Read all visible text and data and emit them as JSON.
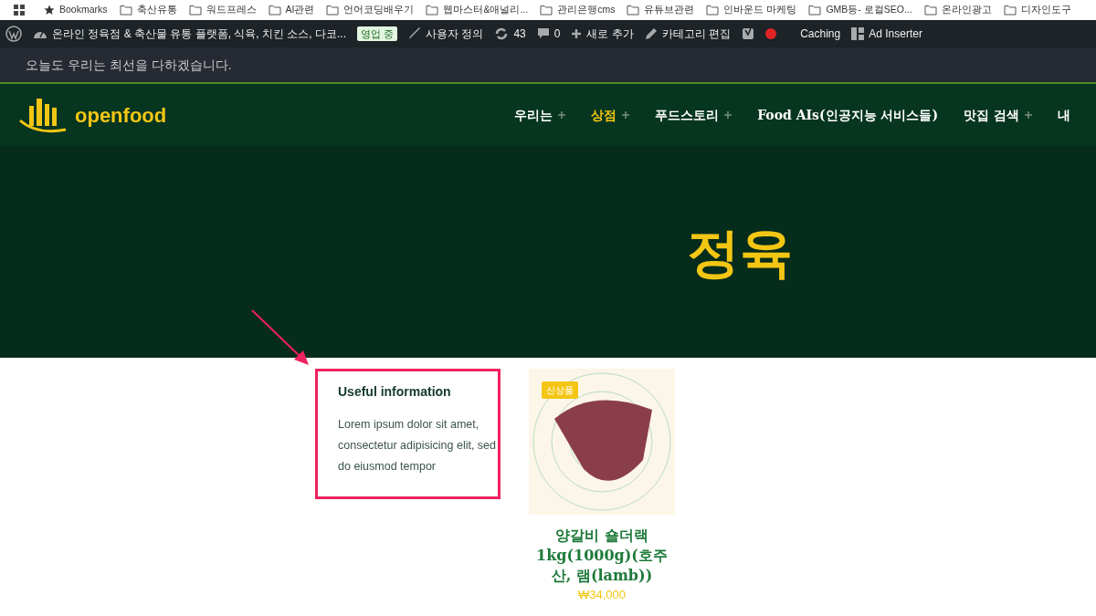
{
  "bookmarks_bar": {
    "items": [
      {
        "kind": "star",
        "label": "Bookmarks"
      },
      {
        "kind": "folder",
        "label": "축산유통"
      },
      {
        "kind": "folder",
        "label": "워드프레스"
      },
      {
        "kind": "folder",
        "label": "AI관련"
      },
      {
        "kind": "folder",
        "label": "언어코딩배우기"
      },
      {
        "kind": "folder",
        "label": "웹마스터&애널리..."
      },
      {
        "kind": "folder",
        "label": "관리은행cms"
      },
      {
        "kind": "folder",
        "label": "유튜브관련"
      },
      {
        "kind": "folder",
        "label": "인바운드 마케팅"
      },
      {
        "kind": "folder",
        "label": "GMB등- 로컬SEO..."
      },
      {
        "kind": "folder",
        "label": "온라인광고"
      },
      {
        "kind": "folder",
        "label": "디자인도구"
      }
    ]
  },
  "admin_bar": {
    "items": [
      {
        "kind": "wp"
      },
      {
        "kind": "site",
        "label": "온라인 정육점 & 축산물 유통 플랫폼, 식육, 치킨 소스, 다코..."
      },
      {
        "kind": "status",
        "label": "영업 중"
      },
      {
        "kind": "brush",
        "label": "사용자 정의"
      },
      {
        "kind": "updates",
        "label": "43"
      },
      {
        "kind": "comments",
        "label": "0"
      },
      {
        "kind": "plus",
        "label": "새로 추가"
      },
      {
        "kind": "pencil",
        "label": "카테고리 편집"
      },
      {
        "kind": "yoast"
      },
      {
        "kind": "dot",
        "color": "#e02424"
      },
      {
        "kind": "text",
        "label": "Caching"
      },
      {
        "kind": "adinserter",
        "label": "Ad Inserter"
      }
    ]
  },
  "top_bar": {
    "text": "오늘도 우리는 최선을 다하겠습니다."
  },
  "header": {
    "logo_text": "openfood",
    "nav": [
      {
        "label": "우리는",
        "selected": false,
        "has_submenu": true
      },
      {
        "label": "상점",
        "selected": true,
        "has_submenu": true
      },
      {
        "label": "푸드스토리",
        "selected": false,
        "has_submenu": true
      },
      {
        "label": "Food AIs(인공지능 서비스들)",
        "selected": false,
        "has_submenu": false
      },
      {
        "label": "맛집 검색",
        "selected": false,
        "has_submenu": true
      },
      {
        "label": "내",
        "selected": false,
        "has_submenu": false
      }
    ]
  },
  "hero": {
    "title": "정육"
  },
  "widget": {
    "title": "Useful information",
    "text": "Lorem ipsum dolor sit amet, consectetur adipisicing elit, sed do eiusmod tempor",
    "highlighted": true
  },
  "product": {
    "badge": "신상품",
    "name": "양갈비 숄더랙 1kg(1000g)(호주산, 램(lamb))",
    "price": "₩34,000"
  }
}
